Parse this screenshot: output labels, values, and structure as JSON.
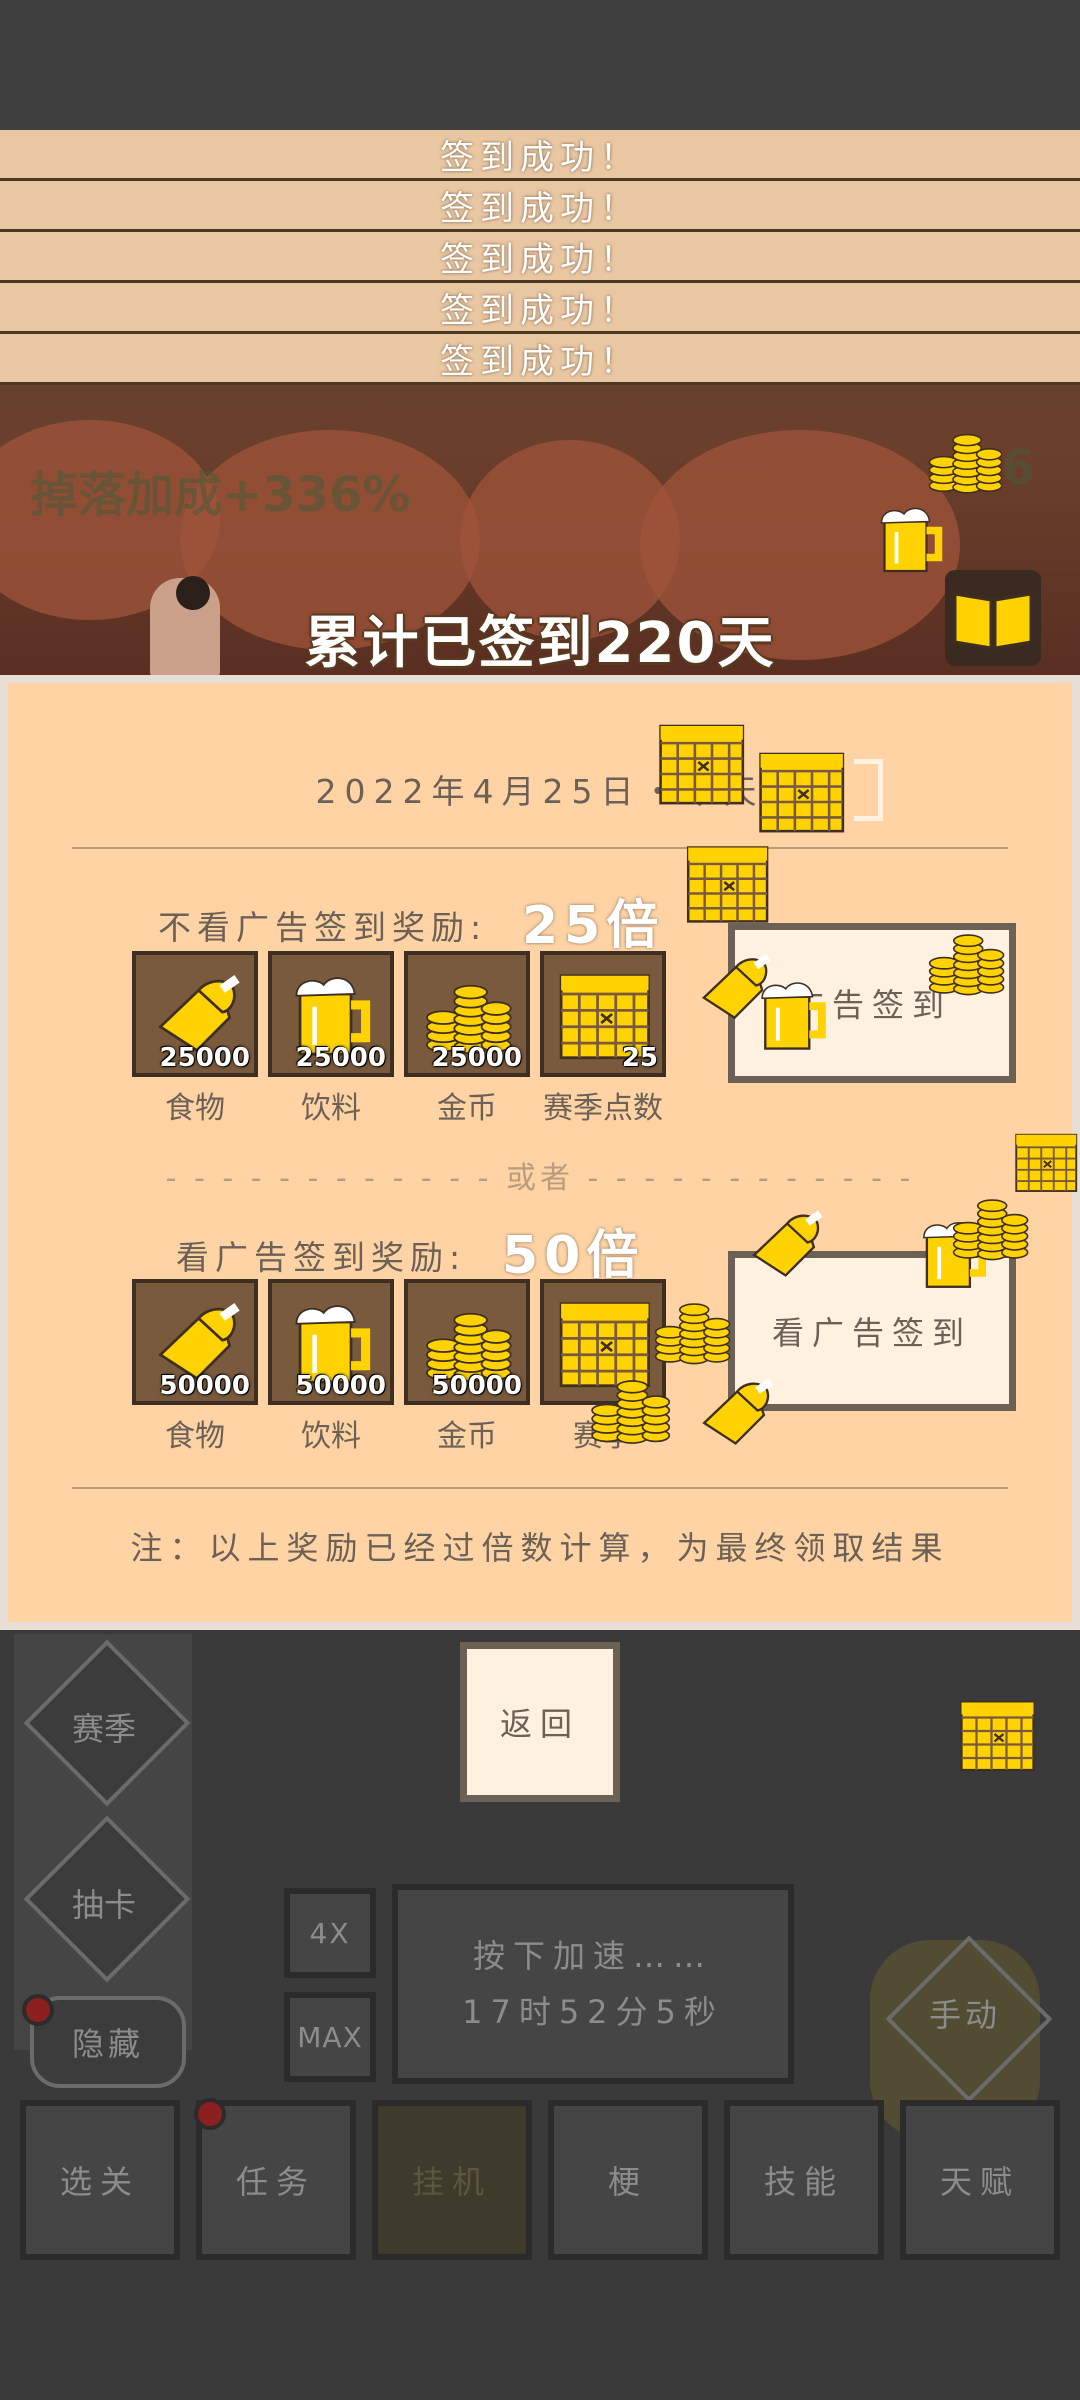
{
  "toasts": [
    "签到成功！",
    "签到成功！",
    "签到成功！",
    "签到成功！",
    "签到成功！"
  ],
  "hud": {
    "drop_bonus": "掉落加成+336%",
    "right_value": "1.6"
  },
  "streak_text": "累计已签到220天",
  "panel": {
    "date_text": "2022年4月25日・今天",
    "no_ad": {
      "label": "不看广告签到奖励:",
      "multiplier": "25倍",
      "button": "广告签到",
      "items": [
        {
          "icon": "meat-icon",
          "qty": "25000",
          "label": "食物"
        },
        {
          "icon": "beer-icon",
          "qty": "25000",
          "label": "饮料"
        },
        {
          "icon": "coins-icon",
          "qty": "25000",
          "label": "金币"
        },
        {
          "icon": "calendar-icon",
          "qty": "25",
          "label": "赛季点数"
        }
      ]
    },
    "or_text": "或者",
    "ad": {
      "label": "看广告签到奖励:",
      "multiplier": "50倍",
      "button": "看广告签到",
      "items": [
        {
          "icon": "meat-icon",
          "qty": "50000",
          "label": "食物"
        },
        {
          "icon": "beer-icon",
          "qty": "50000",
          "label": "饮料"
        },
        {
          "icon": "coins-icon",
          "qty": "50000",
          "label": "金币"
        },
        {
          "icon": "calendar-icon",
          "qty": "",
          "label": "赛季"
        }
      ]
    },
    "note": "注：以上奖励已经过倍数计算，为最终领取结果"
  },
  "back_button": "返回",
  "sidebar": {
    "season": "赛季",
    "draw": "抽卡",
    "hide": "隐藏"
  },
  "speed": {
    "x4": "4X",
    "max": "MAX",
    "line1": "按下加速……",
    "line2": "17时52分5秒"
  },
  "right_button": "手动",
  "bottom_nav": [
    {
      "label": "选关",
      "active": false
    },
    {
      "label": "任务",
      "active": false
    },
    {
      "label": "挂机",
      "active": true
    },
    {
      "label": "梗",
      "active": false
    },
    {
      "label": "技能",
      "active": false
    },
    {
      "label": "天赋",
      "active": false
    }
  ],
  "colors": {
    "panel_bg": "#ffd3a3",
    "gold": "#ffd200",
    "text": "#6b6157",
    "toast_bg": "#e9c7a2"
  }
}
